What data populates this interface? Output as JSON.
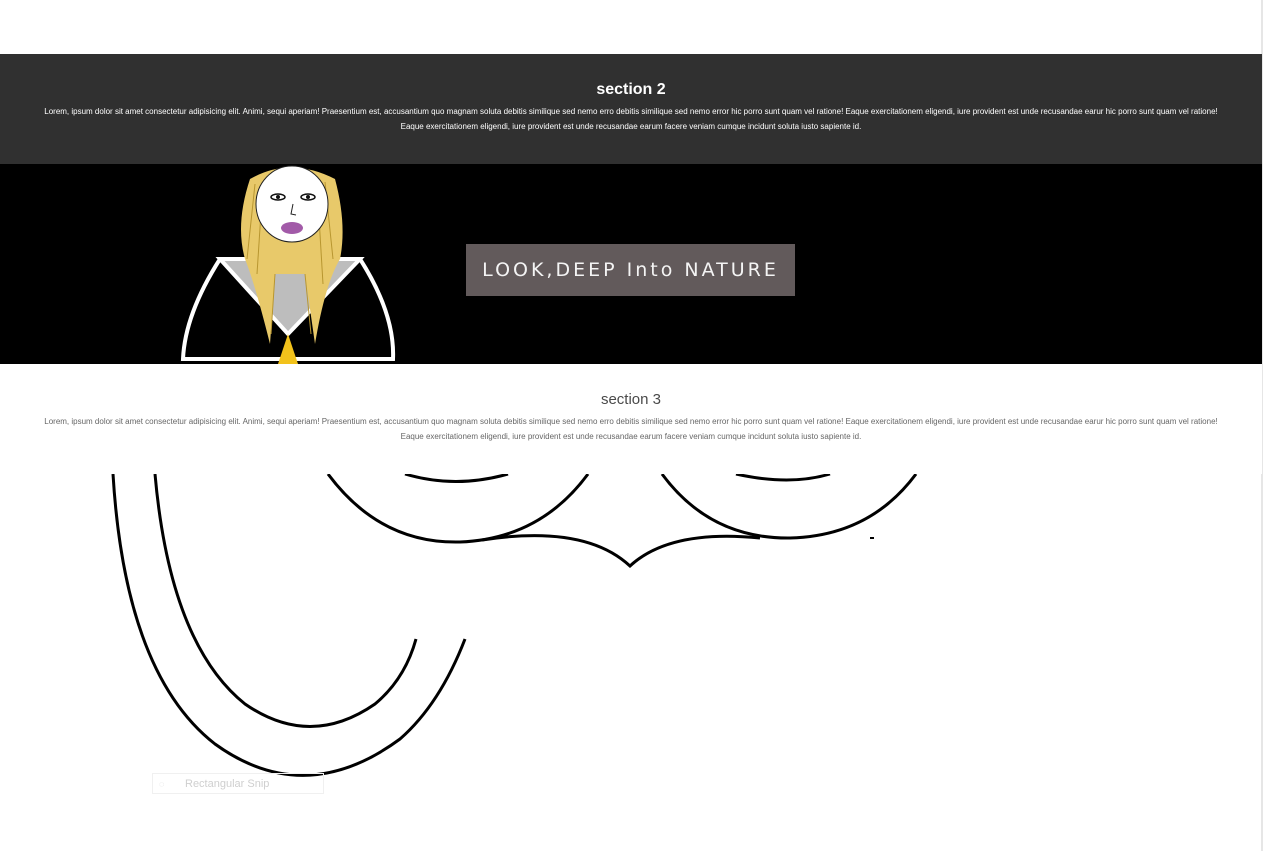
{
  "section2": {
    "title": "section 2",
    "body": "Lorem, ipsum dolor sit amet consectetur adipisicing elit. Animi, sequi aperiam! Praesentium est, accusantium quo magnam soluta debitis similique sed nemo erro debitis similique sed nemo error hic porro sunt quam vel ratione! Eaque exercitationem eligendi, iure provident est unde recusandae earur hic porro sunt quam vel ratione! Eaque exercitationem eligendi, iure provident est unde recusandae earum facere veniam cumque incidunt soluta iusto sapiente id."
  },
  "banner": {
    "text": "LOOK,DEEP Into NATURE"
  },
  "section3": {
    "title": "section 3",
    "body": "Lorem, ipsum dolor sit amet consectetur adipisicing elit. Animi, sequi aperiam! Praesentium est, accusantium quo magnam soluta debitis similique sed nemo erro debitis similique sed nemo error hic porro sunt quam vel ratione! Eaque exercitationem eligendi, iure provident est unde recusandae earur hic porro sunt quam vel ratione! Eaque exercitationem eligendi, iure provident est unde recusandae earum facere veniam cumque incidunt soluta iusto sapiente id."
  },
  "snip_tool": {
    "label": "Rectangular Snip",
    "icon": "snip-icon"
  },
  "colors": {
    "section2_bg": "#303030",
    "banner_bg": "#000000",
    "banner_box": "#625a5b",
    "hair": "#e8c96a",
    "lips": "#a25aa8",
    "shirt": "#bdbdbd",
    "tie": "#f2c21b"
  }
}
